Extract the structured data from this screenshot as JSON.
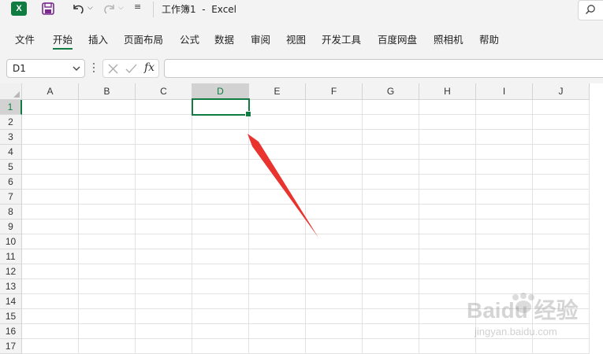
{
  "app": {
    "logo_letter": "X",
    "title": "工作簿1  -  Excel",
    "accent_color": "#107c41"
  },
  "quick_access": {
    "icons": [
      "save-icon",
      "undo-icon",
      "redo-icon",
      "customize-qat-icon"
    ]
  },
  "ribbon": {
    "tabs": [
      {
        "label": "文件"
      },
      {
        "label": "开始",
        "active": true
      },
      {
        "label": "插入"
      },
      {
        "label": "页面布局"
      },
      {
        "label": "公式"
      },
      {
        "label": "数据"
      },
      {
        "label": "审阅"
      },
      {
        "label": "视图"
      },
      {
        "label": "开发工具"
      },
      {
        "label": "百度网盘"
      },
      {
        "label": "照相机"
      },
      {
        "label": "帮助"
      }
    ]
  },
  "formula_bar": {
    "name_box_value": "D1",
    "fx_label": "fx",
    "formula_value": ""
  },
  "sheet": {
    "columns": [
      "A",
      "B",
      "C",
      "D",
      "E",
      "F",
      "G",
      "H",
      "I",
      "J"
    ],
    "rows": [
      "1",
      "2",
      "3",
      "4",
      "5",
      "6",
      "7",
      "8",
      "9",
      "10",
      "11",
      "12",
      "13",
      "14",
      "15",
      "16",
      "17"
    ],
    "selected_column": "D",
    "selected_row": "1",
    "active_cell": "D1"
  },
  "annotation": {
    "arrow_color": "#e8332e",
    "points_to": "D1"
  },
  "watermark": {
    "text": "Baidu 经验",
    "subtext": "jingyan.baidu.com"
  }
}
